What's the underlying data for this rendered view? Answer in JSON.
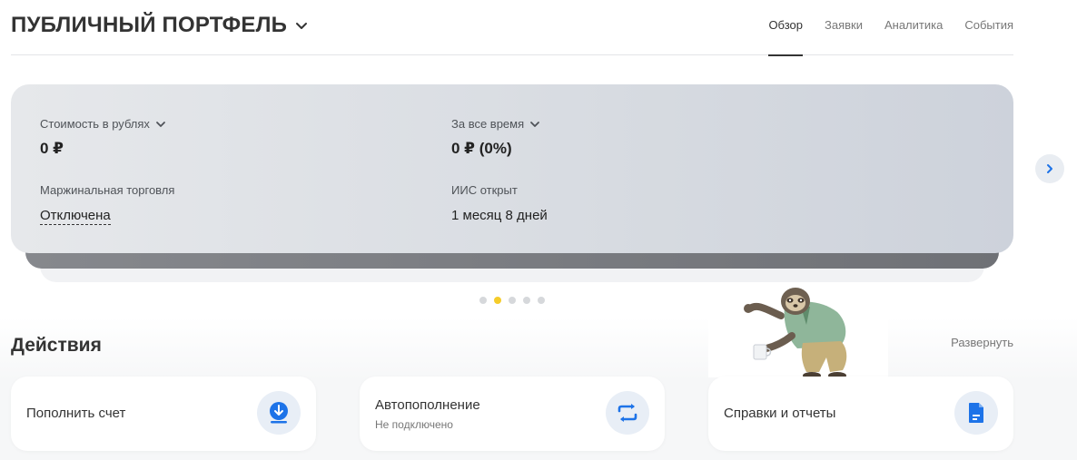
{
  "header": {
    "title": "ПУБЛИЧНЫЙ ПОРТФЕЛЬ",
    "tabs": [
      {
        "label": "Обзор",
        "active": true
      },
      {
        "label": "Заявки",
        "active": false
      },
      {
        "label": "Аналитика",
        "active": false
      },
      {
        "label": "События",
        "active": false
      }
    ]
  },
  "summary": {
    "value_label": "Стоимость в рублях",
    "value": "0 ₽",
    "period_label": "За все время",
    "period_value": "0 ₽ (0%)",
    "margin_label": "Маржинальная торговля",
    "margin_value": "Отключена",
    "iis_label": "ИИС открыт",
    "iis_value": "1 месяц 8 дней"
  },
  "carousel": {
    "dots": 5,
    "active_index": 1
  },
  "actions": {
    "title": "Действия",
    "expand_label": "Развернуть",
    "items": [
      {
        "title": "Пополнить счет",
        "subtitle": "",
        "icon": "download-icon"
      },
      {
        "title": "Автопополнение",
        "subtitle": "Не подключено",
        "icon": "repeat-icon"
      },
      {
        "title": "Справки и отчеты",
        "subtitle": "",
        "icon": "document-icon"
      }
    ]
  },
  "colors": {
    "accent_blue": "#1d73e8",
    "active_dot": "#f5cc2a",
    "icon_bg": "#e8eef6"
  }
}
